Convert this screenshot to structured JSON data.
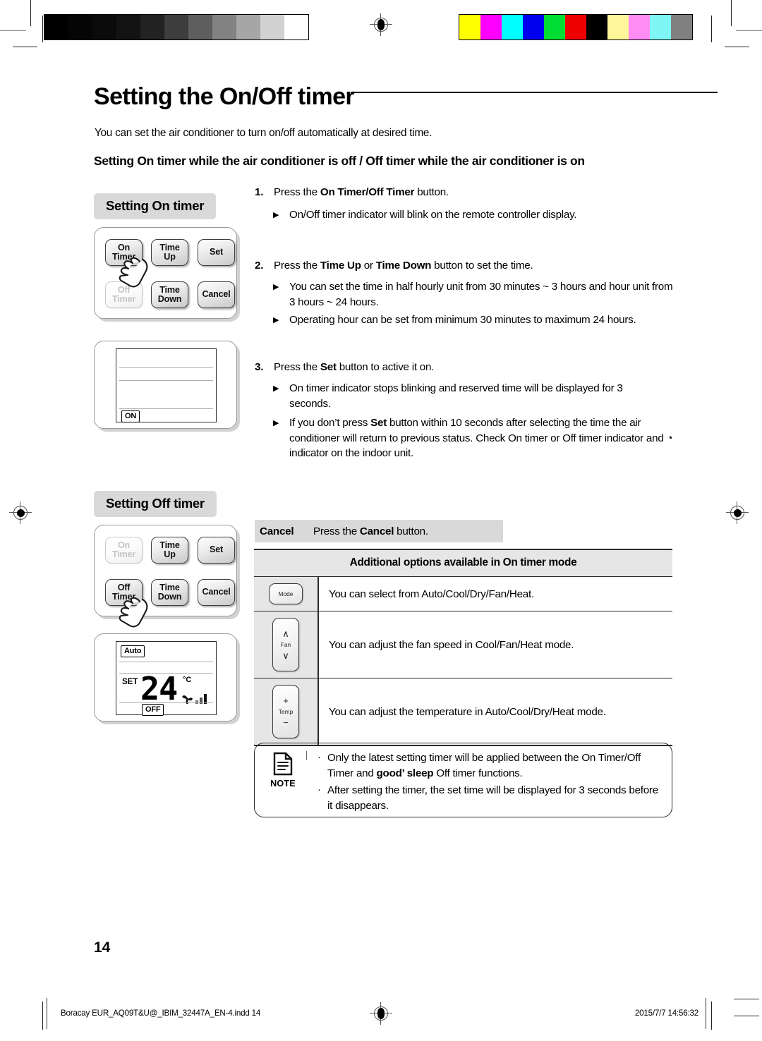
{
  "page": {
    "title": "Setting the On/Off timer",
    "intro": "You can set the air conditioner to turn on/off automatically at desired time.",
    "subhead": "Setting On timer while the air conditioner is off / Off timer while the air conditioner is on",
    "page_number": "14"
  },
  "sections": {
    "on_timer_chip": "Setting On timer",
    "off_timer_chip": "Setting Off timer"
  },
  "keypad": {
    "on_timer": "On\nTimer",
    "on_timer_l1": "On",
    "on_timer_l2": "Timer",
    "off_timer_l1": "Off",
    "off_timer_l2": "Timer",
    "time_up_l1": "Time",
    "time_up_l2": "Up",
    "time_down_l1": "Time",
    "time_down_l2": "Down",
    "set": "Set",
    "cancel": "Cancel"
  },
  "lcd_on": {
    "indicator": "ON"
  },
  "lcd_off": {
    "mode": "Auto",
    "set_label": "SET",
    "temperature": "24",
    "unit": "°C",
    "indicator": "OFF",
    "fan_bars": 3
  },
  "steps": [
    {
      "num": "1.",
      "text_parts": [
        {
          "t": "Press the ",
          "b": false
        },
        {
          "t": "On Timer/Off Timer",
          "b": true
        },
        {
          "t": " button.",
          "b": false
        }
      ],
      "bullets": [
        [
          {
            "t": "On/Off timer indicator will blink on the remote controller display.",
            "b": false
          }
        ]
      ]
    },
    {
      "num": "2.",
      "text_parts": [
        {
          "t": "Press the ",
          "b": false
        },
        {
          "t": "Time Up",
          "b": true
        },
        {
          "t": " or ",
          "b": false
        },
        {
          "t": "Time Down",
          "b": true
        },
        {
          "t": " button to set the time.",
          "b": false
        }
      ],
      "bullets": [
        [
          {
            "t": "You can set the time in half hourly unit from 30 minutes ~ 3 hours and hour unit from 3 hours ~ 24 hours.",
            "b": false
          }
        ],
        [
          {
            "t": "Operating hour can be set from minimum 30 minutes to maximum 24 hours.",
            "b": false
          }
        ]
      ]
    },
    {
      "num": "3.",
      "text_parts": [
        {
          "t": "Press the ",
          "b": false
        },
        {
          "t": "Set",
          "b": true
        },
        {
          "t": " button to active it on.",
          "b": false
        }
      ],
      "bullets": [
        [
          {
            "t": "On timer indicator stops blinking and reserved time will be displayed for 3 seconds.",
            "b": false
          }
        ],
        [
          {
            "t": "If you don’t press ",
            "b": false
          },
          {
            "t": "Set",
            "b": true
          },
          {
            "t": " button within 10 seconds after selecting the time the air conditioner will return to previous status. Check On timer or Off timer indicator and ◔ indicator on the indoor unit.",
            "b": false
          }
        ]
      ]
    }
  ],
  "cancel_strip": {
    "label": "Cancel",
    "text_parts": [
      {
        "t": "Press the ",
        "b": false
      },
      {
        "t": "Cancel",
        "b": true
      },
      {
        "t": " button.",
        "b": false
      }
    ]
  },
  "options_table": {
    "header": "Additional options available in On timer mode",
    "rows": [
      {
        "icon": "mode-button-icon",
        "icon_label": "Mode",
        "text": "You can select from Auto/Cool/Dry/Fan/Heat."
      },
      {
        "icon": "fan-updown-button-icon",
        "icon_label": "Fan",
        "text": "You can adjust the fan speed in Cool/Fan/Heat mode."
      },
      {
        "icon": "temp-plusminus-button-icon",
        "icon_label": "Temp",
        "text": "You can adjust the temperature in Auto/Cool/Dry/Heat mode."
      }
    ]
  },
  "note": {
    "label": "NOTE",
    "items": [
      [
        {
          "t": "Only the latest setting timer will be applied between the On Timer/Off Timer and ",
          "b": false
        },
        {
          "t": "good’ sleep",
          "b": true
        },
        {
          "t": " Off timer functions.",
          "b": false
        }
      ],
      [
        {
          "t": "After setting the timer, the set time will be displayed for 3 seconds before it disappears.",
          "b": false
        }
      ]
    ]
  },
  "footer": {
    "left": "Boracay EUR_AQ09T&U@_IBIM_32447A_EN-4.indd   14",
    "right": "2015/7/7   14:56:32"
  },
  "calibration": {
    "grayscale_swatches": [
      "#000000",
      "#050505",
      "#0b0b0b",
      "#131313",
      "#222222",
      "#3d3d3d",
      "#5e5e5e",
      "#828282",
      "#a6a6a6",
      "#d2d2d2",
      "#ffffff"
    ],
    "color_swatches": [
      "#ffff00",
      "#ff00ff",
      "#00ffff",
      "#0000ee",
      "#00dd33",
      "#ee0000",
      "#000000",
      "#fff69a",
      "#ff8cf5",
      "#7ef6f6",
      "#808080"
    ]
  }
}
